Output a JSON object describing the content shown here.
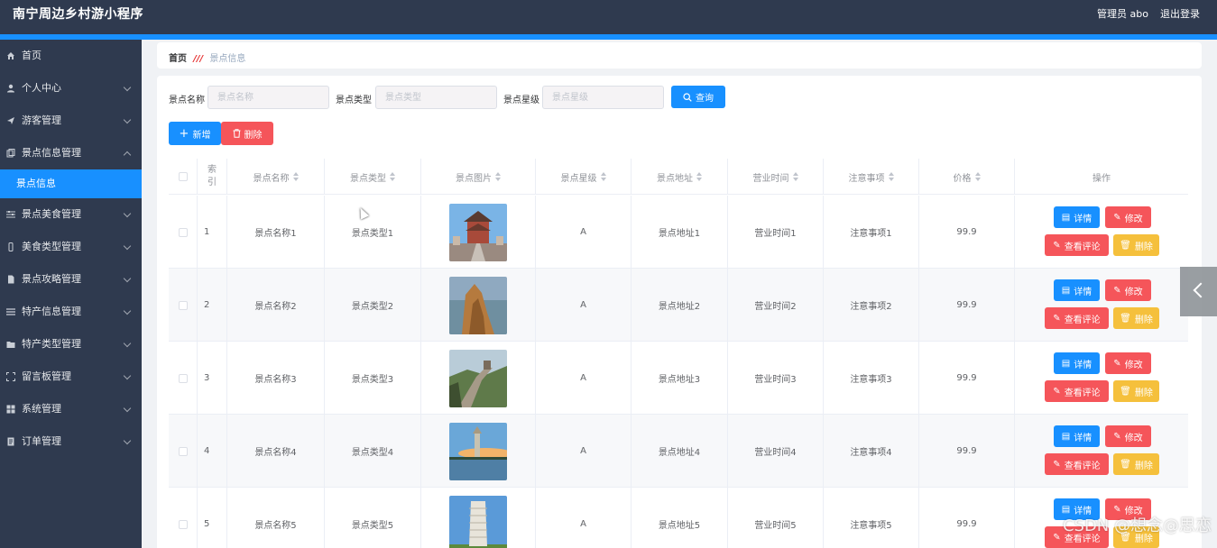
{
  "header": {
    "app_title": "南宁周边乡村游小程序",
    "admin": "管理员 abo",
    "logout": "退出登录"
  },
  "sidebar": {
    "items": [
      {
        "label": "首页",
        "icon": "home-icon",
        "has_arrow": false
      },
      {
        "label": "个人中心",
        "icon": "user-icon",
        "has_arrow": true
      },
      {
        "label": "游客管理",
        "icon": "send-icon",
        "has_arrow": true
      },
      {
        "label": "景点信息管理",
        "icon": "copy-icon",
        "has_arrow": true,
        "expanded": true
      },
      {
        "label": "景点信息",
        "sub": true,
        "active": true
      },
      {
        "label": "景点美食管理",
        "icon": "sliders-icon",
        "has_arrow": true
      },
      {
        "label": "美食类型管理",
        "icon": "phone-icon",
        "has_arrow": true
      },
      {
        "label": "景点攻略管理",
        "icon": "file-icon",
        "has_arrow": true
      },
      {
        "label": "特产信息管理",
        "icon": "list-icon",
        "has_arrow": true
      },
      {
        "label": "特产类型管理",
        "icon": "folder-icon",
        "has_arrow": true
      },
      {
        "label": "留言板管理",
        "icon": "frame-icon",
        "has_arrow": true
      },
      {
        "label": "系统管理",
        "icon": "grid-icon",
        "has_arrow": true
      },
      {
        "label": "订单管理",
        "icon": "doc-icon",
        "has_arrow": true
      }
    ]
  },
  "breadcrumb": {
    "home": "首页",
    "separator": "///",
    "current": "景点信息"
  },
  "search": {
    "name_label": "景点名称",
    "name_placeholder": "景点名称",
    "type_label": "景点类型",
    "type_placeholder": "景点类型",
    "level_label": "景点星级",
    "level_placeholder": "景点星级",
    "query_button": "查询"
  },
  "toolbar": {
    "add_button": "新增",
    "delete_button": "删除"
  },
  "table": {
    "headers": {
      "index": "索引",
      "name": "景点名称",
      "type": "景点类型",
      "image": "景点图片",
      "level": "景点星级",
      "address": "景点地址",
      "hours": "营业时间",
      "notes": "注意事项",
      "price": "价格",
      "ops": "操作"
    },
    "rows": [
      {
        "index": "1",
        "name": "景点名称1",
        "type": "景点类型1",
        "level": "A",
        "address": "景点地址1",
        "hours": "营业时间1",
        "notes": "注意事项1",
        "price": "99.9"
      },
      {
        "index": "2",
        "name": "景点名称2",
        "type": "景点类型2",
        "level": "A",
        "address": "景点地址2",
        "hours": "营业时间2",
        "notes": "注意事项2",
        "price": "99.9"
      },
      {
        "index": "3",
        "name": "景点名称3",
        "type": "景点类型3",
        "level": "A",
        "address": "景点地址3",
        "hours": "营业时间3",
        "notes": "注意事项3",
        "price": "99.9"
      },
      {
        "index": "4",
        "name": "景点名称4",
        "type": "景点类型4",
        "level": "A",
        "address": "景点地址4",
        "hours": "营业时间4",
        "notes": "注意事项4",
        "price": "99.9"
      },
      {
        "index": "5",
        "name": "景点名称5",
        "type": "景点类型5",
        "level": "A",
        "address": "景点地址5",
        "hours": "营业时间5",
        "notes": "注意事项5",
        "price": "99.9"
      }
    ],
    "op_labels": {
      "detail": "详情",
      "edit": "修改",
      "reviews": "查看评论",
      "delete": "删除"
    }
  },
  "watermark": "CSDN @想念@思恋",
  "colors": {
    "primary": "#1890ff",
    "danger": "#f5555a",
    "warning": "#f5c03c",
    "sidebar": "#2f3a4f"
  }
}
